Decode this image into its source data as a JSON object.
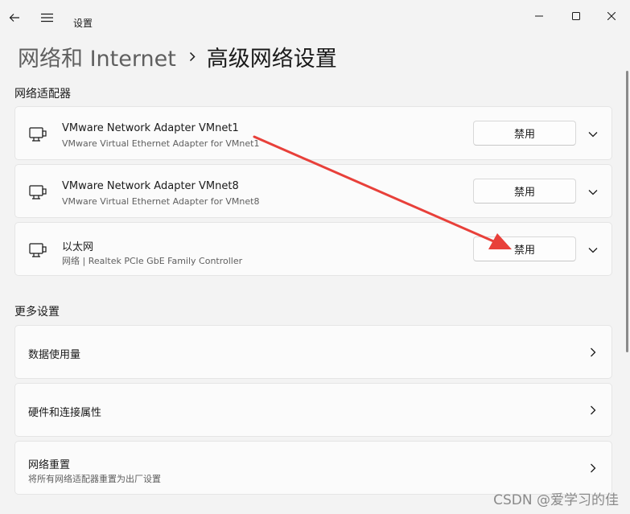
{
  "window": {
    "app_title": "设置",
    "back_icon": "back-arrow-icon",
    "menu_icon": "hamburger-menu-icon"
  },
  "breadcrumb": {
    "parent": "网络和 Internet",
    "current": "高级网络设置"
  },
  "sections": {
    "adapters_title": "网络适配器",
    "more_title": "更多设置"
  },
  "adapters": [
    {
      "name": "VMware Network Adapter VMnet1",
      "description": "VMware Virtual Ethernet Adapter for VMnet1",
      "button": "禁用"
    },
    {
      "name": "VMware Network Adapter VMnet8",
      "description": "VMware Virtual Ethernet Adapter for VMnet8",
      "button": "禁用"
    },
    {
      "name": "以太网",
      "description": "网络 | Realtek PCIe GbE Family Controller",
      "button": "禁用"
    }
  ],
  "more_settings": [
    {
      "label": "数据使用量"
    },
    {
      "label": "硬件和连接属性"
    },
    {
      "label": "网络重置",
      "sub": "将所有网络适配器重置为出厂设置"
    }
  ],
  "watermark": "CSDN @爱学习的佳",
  "colors": {
    "background": "#f3f3f3",
    "card": "#fbfbfb",
    "annotation_arrow": "#e8403a"
  }
}
